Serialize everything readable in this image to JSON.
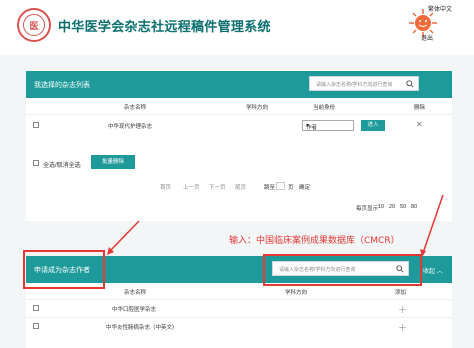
{
  "header": {
    "title": "中华医学会杂志社远程稿件管理系统",
    "lang_switch": "繁体中文",
    "exit_label": "退出"
  },
  "colors": {
    "accent": "#1e9a9a",
    "title": "#0b6f70",
    "annotation": "#e53935"
  },
  "selected_panel": {
    "title": "我选择的杂志列表",
    "search_placeholder": "请输入杂志名称/学科方向进行查询",
    "columns": {
      "name": "杂志名称",
      "subject": "学科方向",
      "role": "当前身份",
      "delete": "删除"
    },
    "rows": [
      {
        "name": "中华现代护理杂志",
        "subject": "",
        "role": "作者",
        "action": "进入"
      }
    ],
    "select_all": "全选/取消全选",
    "batch_delete": "批量删除",
    "pager": {
      "first": "首页",
      "prev": "上一页",
      "next": "下一页",
      "last": "尾页",
      "jump": "跳至",
      "page": "页",
      "confirm": "确定",
      "per_page_label": "每页显示",
      "sizes": [
        "10",
        "20",
        "50",
        "80"
      ]
    }
  },
  "apply_panel": {
    "title": "申请成为杂志作者",
    "search_placeholder": "请输入杂志名称/学科方向进行查询",
    "collapse_label": "收起",
    "columns": {
      "name": "杂志名称",
      "subject": "学科方向",
      "add": "添加"
    },
    "rows": [
      {
        "name": "中华口腔医学杂志"
      },
      {
        "name": "中华炎性肠病杂志（中英文）"
      }
    ]
  },
  "annotation": "输入：中国临床案例成果数据库（CMCR）"
}
